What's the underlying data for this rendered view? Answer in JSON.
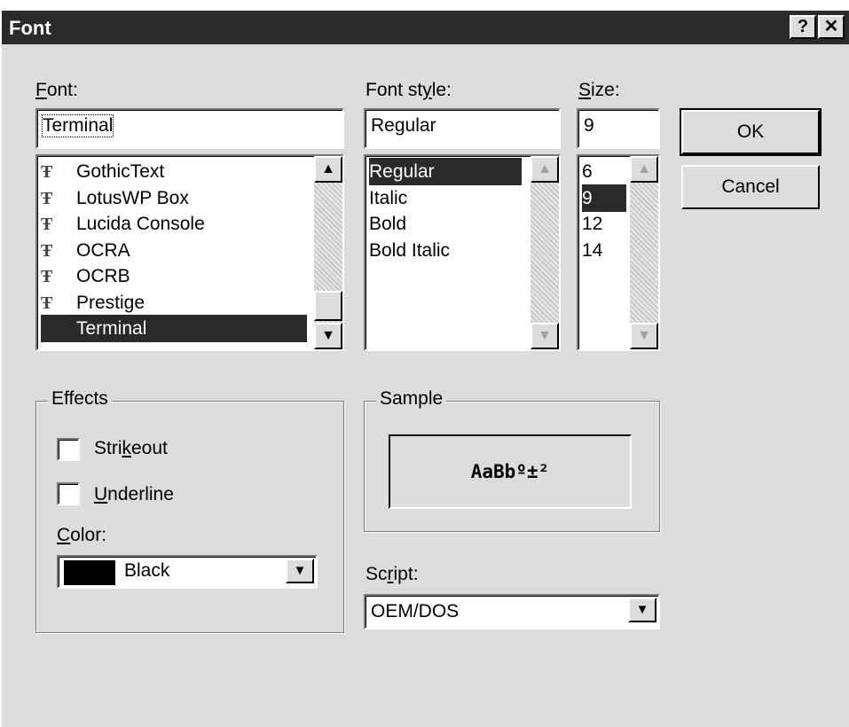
{
  "window": {
    "title": "Font",
    "help_btn": "?",
    "close_btn": "✕"
  },
  "font": {
    "label_u": "F",
    "label_rest": "ont:",
    "value": "Terminal",
    "items": [
      "GothicText",
      "LotusWP Box",
      "Lucida Console",
      "OCRA",
      "OCRB",
      "Prestige",
      "Terminal"
    ],
    "selected": "Terminal"
  },
  "style": {
    "label_a": "Font st",
    "label_u": "y",
    "label_b": "le:",
    "value": "Regular",
    "items": [
      "Regular",
      "Italic",
      "Bold",
      "Bold Italic"
    ],
    "selected": "Regular"
  },
  "size": {
    "label_u": "S",
    "label_rest": "ize:",
    "value": "9",
    "items": [
      "6",
      "9",
      "12",
      "14"
    ],
    "selected": "9"
  },
  "buttons": {
    "ok": "OK",
    "cancel": "Cancel"
  },
  "effects": {
    "legend": "Effects",
    "strikeout_a": "Stri",
    "strikeout_u": "k",
    "strikeout_b": "eout",
    "strikeout_checked": false,
    "underline_u": "U",
    "underline_b": "nderline",
    "underline_checked": false,
    "color_label_u": "C",
    "color_label_b": "olor:",
    "color_value": "Black",
    "color_swatch": "#000000"
  },
  "sample": {
    "legend": "Sample",
    "text": "AaBbº±²"
  },
  "script": {
    "label_a": "Sc",
    "label_u": "r",
    "label_b": "ipt:",
    "value": "OEM/DOS"
  },
  "icons": {
    "arrow_up": "▲",
    "arrow_down": "▼",
    "truetype": "Ŧ"
  }
}
